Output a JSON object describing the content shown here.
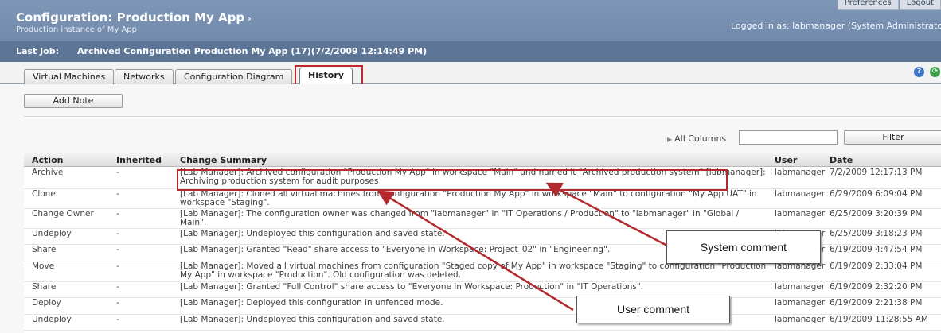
{
  "header": {
    "title": "Configuration: Production My App",
    "title_arrow": "›",
    "subtitle": "Production instance of My App",
    "logged_in": "Logged in as: labmanager (System Administrator)",
    "top_links": [
      "Preferences",
      "Logout"
    ],
    "last_job_label": "Last Job:",
    "last_job_value": "Archived Configuration Production My App (17)(7/2/2009 12:14:49 PM)"
  },
  "tabs": [
    {
      "label": "Virtual Machines",
      "active": false
    },
    {
      "label": "Networks",
      "active": false
    },
    {
      "label": "Configuration Diagram",
      "active": false
    },
    {
      "label": "History",
      "active": true
    }
  ],
  "toolbar": {
    "add_note": "Add Note",
    "all_columns": "All Columns",
    "filter_value": "",
    "filter_button": "Filter",
    "help_icon": "?",
    "refresh_icon": "⟳"
  },
  "table": {
    "headers": [
      "Action",
      "Inherited",
      "Change Summary",
      "User",
      "Date"
    ],
    "rows": [
      {
        "action": "Archive",
        "inherited": "-",
        "summary": "[Lab Manager]: Archived configuration \"Production My App\" in workspace \"Main\" and named it \"Archived production system\" [labmanager]: Archiving production system for audit purposes",
        "user": "labmanager",
        "date": "7/2/2009 12:17:13 PM"
      },
      {
        "action": "Clone",
        "inherited": "-",
        "summary": "[Lab Manager]: Cloned all virtual machines from configuration \"Production My App\" in workspace \"Main\" to configuration \"My App UAT\" in workspace \"Staging\".",
        "user": "labmanager",
        "date": "6/29/2009 6:09:04 PM"
      },
      {
        "action": "Change Owner",
        "inherited": "-",
        "summary": "[Lab Manager]: The configuration owner was changed from \"labmanager\" in \"IT Operations / Production\" to \"labmanager\" in \"Global / Main\".",
        "user": "labmanager",
        "date": "6/25/2009 3:20:39 PM"
      },
      {
        "action": "Undeploy",
        "inherited": "-",
        "summary": "[Lab Manager]: Undeployed this configuration and saved state.",
        "user": "labmanager",
        "date": "6/25/2009 3:18:23 PM"
      },
      {
        "action": "Share",
        "inherited": "-",
        "summary": "[Lab Manager]: Granted \"Read\" share access to \"Everyone in Workspace: Project_02\" in \"Engineering\".",
        "user": "labmanager",
        "date": "6/19/2009 4:47:54 PM"
      },
      {
        "action": "Move",
        "inherited": "-",
        "summary": "[Lab Manager]: Moved all virtual machines from configuration \"Staged copy of My App\" in workspace \"Staging\" to configuration \"Production My App\" in workspace \"Production\". Old configuration was deleted.",
        "user": "labmanager",
        "date": "6/19/2009 2:33:04 PM"
      },
      {
        "action": "Share",
        "inherited": "-",
        "summary": "[Lab Manager]: Granted \"Full Control\" share access to \"Everyone in Workspace: Production\" in \"IT Operations\".",
        "user": "labmanager",
        "date": "6/19/2009 2:32:20 PM"
      },
      {
        "action": "Deploy",
        "inherited": "-",
        "summary": "[Lab Manager]: Deployed this configuration in unfenced mode.",
        "user": "labmanager",
        "date": "6/19/2009 2:21:38 PM"
      },
      {
        "action": "Undeploy",
        "inherited": "-",
        "summary": "[Lab Manager]: Undeployed this configuration and saved state.",
        "user": "labmanager",
        "date": "6/19/2009 11:28:55 AM"
      }
    ]
  },
  "annotations": {
    "system_comment": "System comment",
    "user_comment": "User comment"
  },
  "colors": {
    "header": "#6a84a8",
    "header_bar": "#5d7698",
    "highlight": "#c0282d"
  }
}
